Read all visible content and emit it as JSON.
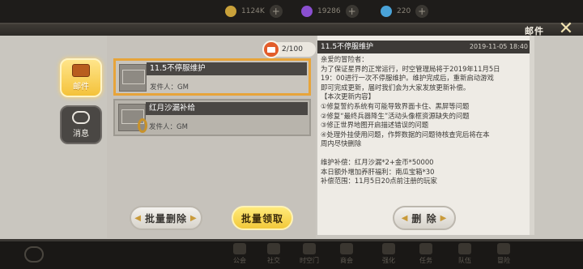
{
  "top_bar": {
    "resources": [
      {
        "value": "1124K",
        "icon": "coin-icon",
        "color": "#c9a13a"
      },
      {
        "value": "19286",
        "icon": "crystal-icon",
        "color": "#8a4fd0"
      },
      {
        "value": "220",
        "icon": "diamond-icon",
        "color": "#4aa3d8"
      }
    ]
  },
  "window": {
    "title": "邮件",
    "close_icon": "close-icon"
  },
  "tabs": [
    {
      "label": "邮件",
      "icon": "mail-icon",
      "active": true
    },
    {
      "label": "消息",
      "icon": "chat-bubble-icon",
      "active": false
    }
  ],
  "mail_counter": "2/100",
  "mail_list": [
    {
      "subject": "11.5不停服维护",
      "sender": "发件人：GM",
      "selected": true,
      "has_attachment": false
    },
    {
      "subject": "红月沙漏补给",
      "sender": "发件人：GM",
      "selected": false,
      "has_attachment": true
    }
  ],
  "detail": {
    "subject": "11.5不停服维护",
    "date": "2019-11-05  18:40",
    "lines": [
      "亲爱的冒险者：",
      "为了保证星界的正常运行，时空管理局将于2019年11月5日",
      "19：00进行一次不停服维护。维护完成后，重新启动游戏",
      "即可完成更新，届时我们会为大家发放更新补偿。",
      "【本次更新内容】",
      "①修复誓约系统有可能导致界面卡住、黑屏等问题",
      "②修复“最终兵器降生”活动头像框资源缺失的问题",
      "③修正世界地图开启描述错误的问题",
      "④处理外挂使用问题，作弊数据的问题待核查完后将在本",
      "周内尽快删除",
      "",
      "维护补偿：红月沙漏*2+金币*50000",
      "本日额外增加养肝福利：南瓜宝箱*30",
      "补偿范围：11月5日20点前注册的玩家"
    ]
  },
  "buttons": {
    "batch_delete": "批量删除",
    "batch_claim": "批量领取",
    "delete": "删  除"
  },
  "bottom_nav": [
    {
      "label": "公会",
      "icon": "guild-icon"
    },
    {
      "label": "社交",
      "icon": "social-icon"
    },
    {
      "label": "时空门",
      "icon": "portal-icon"
    },
    {
      "label": "商会",
      "icon": "shop-icon"
    },
    {
      "label": "强化",
      "icon": "enhance-icon"
    },
    {
      "label": "任务",
      "icon": "quest-icon"
    },
    {
      "label": "队伍",
      "icon": "team-icon"
    },
    {
      "label": "冒险",
      "icon": "adventure-icon"
    }
  ]
}
